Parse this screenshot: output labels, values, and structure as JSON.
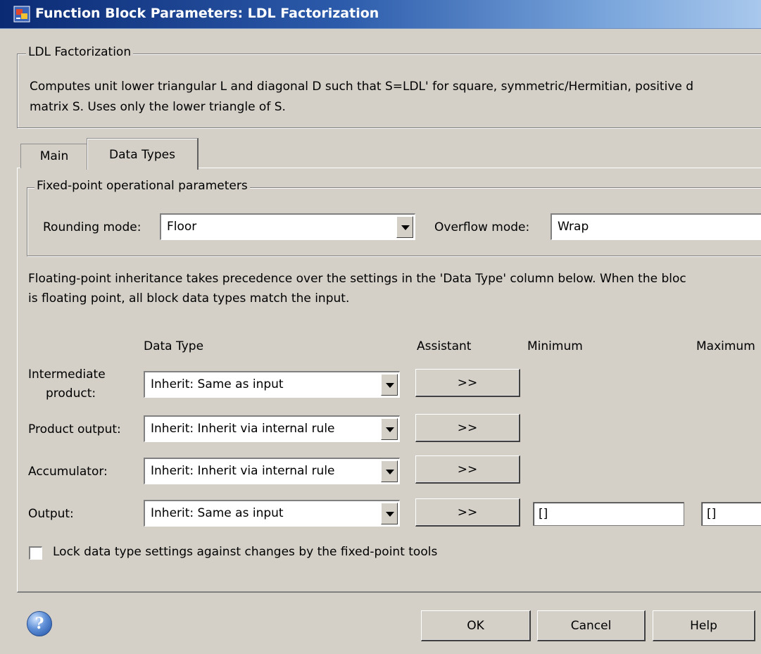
{
  "window": {
    "title": "Function Block Parameters: LDL Factorization"
  },
  "block": {
    "name": "LDL Factorization",
    "description_line1": "Computes unit lower triangular L and diagonal D such that S=LDL' for square, symmetric/Hermitian, positive d",
    "description_line2": "matrix S. Uses only the lower triangle of S."
  },
  "tabs": [
    {
      "label": "Main",
      "selected": false
    },
    {
      "label": "Data Types",
      "selected": true
    }
  ],
  "fixed_point": {
    "group_label": "Fixed-point operational parameters",
    "rounding_label": "Rounding mode:",
    "rounding_value": "Floor",
    "overflow_label": "Overflow mode:",
    "overflow_value": "Wrap"
  },
  "info": {
    "line1": "Floating-point inheritance takes precedence over the settings in the 'Data Type' column below. When the bloc",
    "line2": "is floating point, all block data types match the input."
  },
  "columns": {
    "data_type": "Data Type",
    "assistant": "Assistant",
    "minimum": "Minimum",
    "maximum": "Maximum"
  },
  "rows": [
    {
      "label_line1": "Intermediate",
      "label_line2": "product:",
      "value": "Inherit: Same as input",
      "assistant": ">>"
    },
    {
      "label": "Product output:",
      "value": "Inherit: Inherit via internal rule",
      "assistant": ">>"
    },
    {
      "label": "Accumulator:",
      "value": "Inherit: Inherit via internal rule",
      "assistant": ">>"
    },
    {
      "label": "Output:",
      "value": "Inherit: Same as input",
      "assistant": ">>",
      "minimum": "[]",
      "maximum": "[]"
    }
  ],
  "lock": {
    "label": "Lock data type settings against changes by the fixed-point tools",
    "checked": false
  },
  "buttons": {
    "ok": "OK",
    "cancel": "Cancel",
    "help": "Help"
  },
  "icons": {
    "window": "simulink-block-icon",
    "help": "help-icon"
  }
}
